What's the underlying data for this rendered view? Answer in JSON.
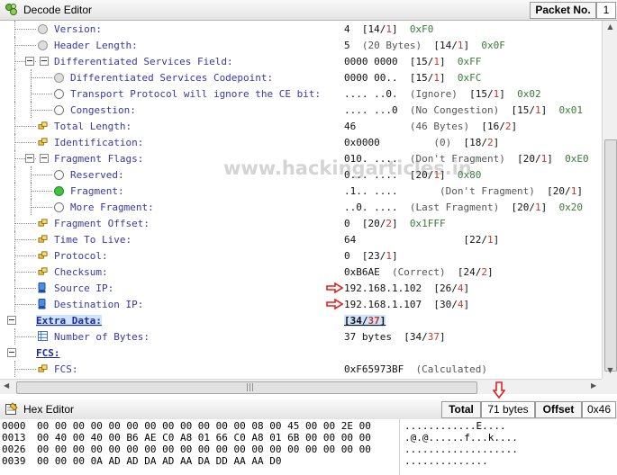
{
  "decode_editor": {
    "title": "Decode Editor",
    "packet_label": "Packet No.",
    "packet_value": "1"
  },
  "tree": [
    {
      "indent": 1,
      "icon": "gray",
      "label": "Version:",
      "value": [
        [
          "4",
          ""
        ],
        [
          "  [14/",
          ""
        ],
        [
          "1",
          "r"
        ],
        [
          "]  ",
          ""
        ],
        [
          "0xF0",
          "o"
        ]
      ]
    },
    {
      "indent": 1,
      "icon": "gray",
      "label": "Header Length:",
      "value": [
        [
          "5",
          ""
        ],
        [
          "  (20 Bytes)",
          "c"
        ],
        [
          "  [14/",
          ""
        ],
        [
          "1",
          "r"
        ],
        [
          "]  ",
          ""
        ],
        [
          "0x0F",
          "o"
        ]
      ]
    },
    {
      "indent": 1,
      "icon": "none",
      "expander": true,
      "label": "Differentiated Services Field:",
      "value": [
        [
          "0000 0000",
          ""
        ],
        [
          "  [15/",
          ""
        ],
        [
          "1",
          "r"
        ],
        [
          "]  ",
          ""
        ],
        [
          "0xFF",
          "o"
        ]
      ]
    },
    {
      "indent": 2,
      "icon": "gray",
      "label": "Differentiated Services Codepoint:",
      "value": [
        [
          "0000 00..",
          ""
        ],
        [
          "  [15/",
          ""
        ],
        [
          "1",
          "r"
        ],
        [
          "]  ",
          ""
        ],
        [
          "0xFC",
          "o"
        ]
      ]
    },
    {
      "indent": 2,
      "icon": "dot",
      "label": "Transport Protocol will ignore the CE bit:",
      "value": [
        [
          ".... ..0.",
          ""
        ],
        [
          "  (Ignore)",
          "c"
        ],
        [
          "  [15/",
          ""
        ],
        [
          "1",
          "r"
        ],
        [
          "]  ",
          ""
        ],
        [
          "0x02",
          "o"
        ]
      ]
    },
    {
      "indent": 2,
      "icon": "dot",
      "label": "Congestion:",
      "value": [
        [
          ".... ...0",
          ""
        ],
        [
          "  (No Congestion)",
          "c"
        ],
        [
          "  [15/",
          ""
        ],
        [
          "1",
          "r"
        ],
        [
          "]  ",
          ""
        ],
        [
          "0x01",
          "o"
        ]
      ]
    },
    {
      "indent": 1,
      "icon": "yellow",
      "label": "Total Length:",
      "value": [
        [
          "46",
          ""
        ],
        [
          "         (46 Bytes)",
          "c"
        ],
        [
          "  [16/",
          ""
        ],
        [
          "2",
          "r"
        ],
        [
          "]",
          ""
        ]
      ]
    },
    {
      "indent": 1,
      "icon": "yellow",
      "label": "Identification:",
      "value": [
        [
          "0x0000",
          ""
        ],
        [
          "         (0)",
          "c"
        ],
        [
          "  [18/",
          ""
        ],
        [
          "2",
          "r"
        ],
        [
          "]",
          ""
        ]
      ]
    },
    {
      "indent": 1,
      "icon": "none",
      "expander": true,
      "label": "Fragment Flags:",
      "value": [
        [
          "010. ....",
          ""
        ],
        [
          "  (Don't Fragment)",
          "c"
        ],
        [
          "  [20/",
          ""
        ],
        [
          "1",
          "r"
        ],
        [
          "]  ",
          ""
        ],
        [
          "0xE0",
          "o"
        ]
      ]
    },
    {
      "indent": 2,
      "icon": "dot",
      "label": "Reserved:",
      "value": [
        [
          "0... ....",
          ""
        ],
        [
          "  [20/",
          ""
        ],
        [
          "1",
          "r"
        ],
        [
          "]  ",
          ""
        ],
        [
          "0x80",
          "o"
        ]
      ]
    },
    {
      "indent": 2,
      "icon": "dotgreen",
      "label": "Fragment:",
      "value": [
        [
          ".1.. ....",
          ""
        ],
        [
          "       (Don't Fragment)",
          "c"
        ],
        [
          "  [20/",
          ""
        ],
        [
          "1",
          "r"
        ],
        [
          "]",
          ""
        ]
      ]
    },
    {
      "indent": 2,
      "icon": "dot",
      "label": "More Fragment:",
      "value": [
        [
          "..0. ....",
          ""
        ],
        [
          "  (Last Fragment)",
          "c"
        ],
        [
          "  [20/",
          ""
        ],
        [
          "1",
          "r"
        ],
        [
          "]  ",
          ""
        ],
        [
          "0x20",
          "o"
        ]
      ]
    },
    {
      "indent": 1,
      "icon": "yellow",
      "label": "Fragment Offset:",
      "value": [
        [
          "0",
          ""
        ],
        [
          "  [20/",
          ""
        ],
        [
          "2",
          "r"
        ],
        [
          "]  ",
          ""
        ],
        [
          "0x1FFF",
          "o"
        ]
      ]
    },
    {
      "indent": 1,
      "icon": "yellow",
      "label": "Time To Live:",
      "value": [
        [
          "64",
          ""
        ],
        [
          "                  [22/",
          ""
        ],
        [
          "1",
          "r"
        ],
        [
          "]",
          ""
        ]
      ]
    },
    {
      "indent": 1,
      "icon": "yellow",
      "label": "Protocol:",
      "value": [
        [
          "0",
          ""
        ],
        [
          "  [23/",
          ""
        ],
        [
          "1",
          "r"
        ],
        [
          "]",
          ""
        ]
      ]
    },
    {
      "indent": 1,
      "icon": "yellow",
      "label": "Checksum:",
      "value": [
        [
          "0xB6AE",
          ""
        ],
        [
          "  (Correct)",
          "c"
        ],
        [
          "  [24/",
          ""
        ],
        [
          "2",
          "r"
        ],
        [
          "]",
          ""
        ]
      ]
    },
    {
      "indent": 1,
      "icon": "blue",
      "label": "Source IP:",
      "arrow": true,
      "value": [
        [
          "192.168.1.102",
          ""
        ],
        [
          "  [26/",
          ""
        ],
        [
          "4",
          "r"
        ],
        [
          "]",
          ""
        ]
      ]
    },
    {
      "indent": 1,
      "icon": "blue",
      "label": "Destination IP:",
      "arrow": true,
      "value": [
        [
          "192.168.1.107",
          ""
        ],
        [
          "  [30/",
          ""
        ],
        [
          "4",
          "r"
        ],
        [
          "]",
          ""
        ]
      ]
    },
    {
      "indent": 0,
      "icon": "none",
      "expander": true,
      "label": "Extra Data:",
      "style": "hl",
      "value": [
        [
          "[34/",
          ""
        ],
        [
          "37",
          "r"
        ],
        [
          "]",
          ""
        ]
      ],
      "valstyle": "hl"
    },
    {
      "indent": 1,
      "icon": "table",
      "label": "Number of Bytes:",
      "value": [
        [
          "37 bytes",
          ""
        ],
        [
          "  [34/",
          ""
        ],
        [
          "37",
          "r"
        ],
        [
          "]",
          ""
        ]
      ]
    },
    {
      "indent": 0,
      "icon": "none",
      "expander": true,
      "label": "FCS:",
      "style": "lnk",
      "value": []
    },
    {
      "indent": 1,
      "icon": "yellow",
      "label": "FCS:",
      "value": [
        [
          "0xF65973BF",
          ""
        ],
        [
          "  (Calculated)",
          "c"
        ]
      ]
    }
  ],
  "watermark": "www.hackingarticles.in",
  "hex_editor": {
    "title": "Hex Editor",
    "total_label": "Total",
    "total_value": "71 bytes",
    "offset_label": "Offset",
    "offset_value": "0x46",
    "rows": [
      {
        "off": "0000",
        "bytes": "00 00 00 00 00 00 00 00 00 00 00 00 08 00 45 00 00 2E 00",
        "ascii": "............E...."
      },
      {
        "off": "0013",
        "bytes": "00 40 00 40 00 B6 AE C0 A8 01 66 C0 A8 01 6B 00 00 00 00",
        "ascii": ".@.@......f...k...."
      },
      {
        "off": "0026",
        "bytes": "00 00 00 00 00 00 00 00 00 00 00 00 00 00 00 00 00 00 00",
        "ascii": "..................."
      },
      {
        "off": "0039",
        "bytes": "00 00 00 0A AD AD DA AD AA DA DD AA AA D0",
        "ascii": ".............."
      }
    ]
  }
}
